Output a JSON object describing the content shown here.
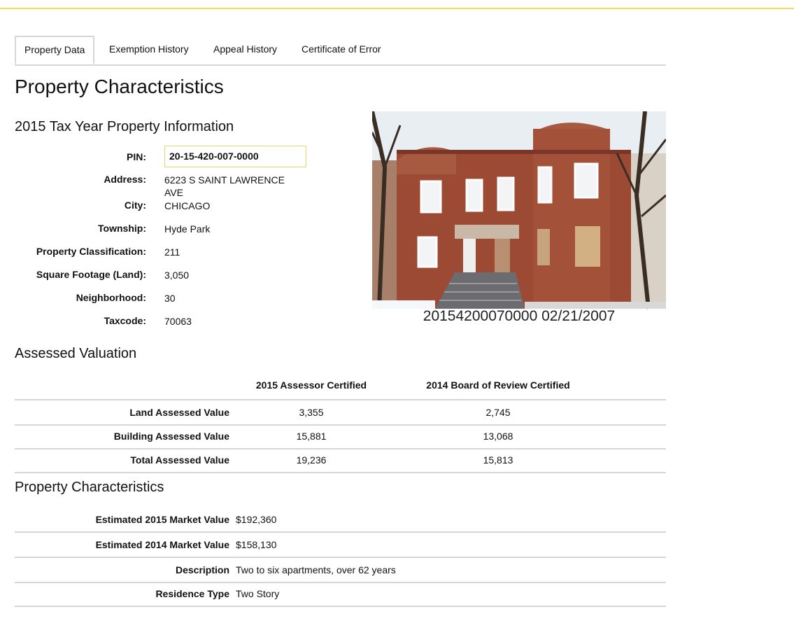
{
  "tabs": [
    {
      "label": "Property Data"
    },
    {
      "label": "Exemption History"
    },
    {
      "label": "Appeal History"
    },
    {
      "label": "Certificate of Error"
    }
  ],
  "page_title": "Property Characteristics",
  "tax_year_section": {
    "heading": "2015 Tax Year Property Information",
    "pin_label": "PIN:",
    "pin_value": "20-15-420-007-0000",
    "fields": [
      {
        "label": "Address:",
        "value": "6223 S SAINT LAWRENCE AVE"
      },
      {
        "label": "City:",
        "value": "CHICAGO"
      },
      {
        "label": "Township:",
        "value": "Hyde Park"
      },
      {
        "label": "Property Classification:",
        "value": "211"
      },
      {
        "label": "Square Footage (Land):",
        "value": "3,050"
      },
      {
        "label": "Neighborhood:",
        "value": "30"
      },
      {
        "label": "Taxcode:",
        "value": "70063"
      }
    ]
  },
  "photo": {
    "caption": "20154200070000  02/21/2007"
  },
  "assessed_valuation": {
    "heading": "Assessed Valuation",
    "col1_header": "2015 Assessor Certified",
    "col2_header": "2014 Board of Review Certified",
    "rows": [
      {
        "label": "Land Assessed Value",
        "v1": "3,355",
        "v2": "2,745"
      },
      {
        "label": "Building Assessed Value",
        "v1": "15,881",
        "v2": "13,068"
      },
      {
        "label": "Total Assessed Value",
        "v1": "19,236",
        "v2": "15,813"
      }
    ]
  },
  "characteristics": {
    "heading": "Property Characteristics",
    "rows": [
      {
        "label": "Estimated 2015 Market Value",
        "value": "$192,360"
      },
      {
        "label": "Estimated 2014 Market Value",
        "value": "$158,130"
      },
      {
        "label": "Description",
        "value": "Two to six apartments, over 62 years"
      },
      {
        "label": "Residence Type",
        "value": "Two Story"
      }
    ]
  },
  "colors": {
    "accent_line": "#f2df55",
    "divider": "#d6d6d6",
    "brick": "#9c4a33"
  }
}
